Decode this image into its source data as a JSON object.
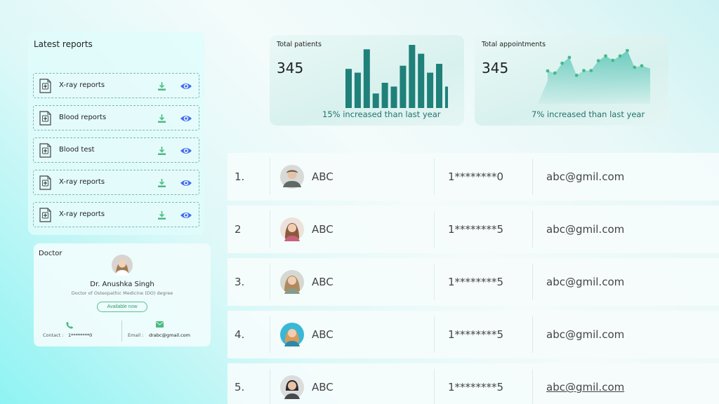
{
  "latest_reports": {
    "title": "Latest reports",
    "items": [
      {
        "label": "X-ray reports"
      },
      {
        "label": "Blood reports"
      },
      {
        "label": "Blood test"
      },
      {
        "label": "X-ray reports"
      },
      {
        "label": "X-ray reports"
      }
    ]
  },
  "doctor": {
    "heading": "Doctor",
    "name": "Dr. Anushka Singh",
    "degree": "Doctor of Osteopathic Medicine (DO) degree",
    "status_button": "Available now",
    "contact_label": "Contact :",
    "contact_value": "1********0",
    "email_label": "Email :",
    "email_value": "drabc@gmail.com"
  },
  "stats": {
    "patients": {
      "title": "Total patients",
      "value": "345",
      "note": "15% increased than last year",
      "bars": [
        0.62,
        0.56,
        0.93,
        0.23,
        0.4,
        0.34,
        0.67,
        1.0,
        0.86,
        0.56,
        0.7,
        0.34
      ]
    },
    "appointments": {
      "title": "Total appointments",
      "value": "345",
      "note": "7% increased than last year",
      "points": [
        0.44,
        0.38,
        0.65,
        0.81,
        0.32,
        0.45,
        0.45,
        0.72,
        0.85,
        0.73,
        0.85,
        1.0,
        0.54,
        0.58
      ]
    }
  },
  "patients_table": {
    "rows": [
      {
        "index": "1.",
        "name": "ABC",
        "phone": "1********0",
        "email": "abc@gmil.com"
      },
      {
        "index": "2",
        "name": "ABC",
        "phone": "1********5",
        "email": "abc@gmil.com"
      },
      {
        "index": "3.",
        "name": "ABC",
        "phone": "1********5",
        "email": "abc@gmil.com"
      },
      {
        "index": "4.",
        "name": "ABC",
        "phone": "1********5",
        "email": "abc@gmil.com"
      },
      {
        "index": "5.",
        "name": "ABC",
        "phone": "1********5",
        "email": "abc@gmil.com"
      }
    ]
  },
  "colors": {
    "bar": "#20807a",
    "area_top": "#5fc7b8",
    "point": "#47b98a",
    "download_icon": "#4cbb7f",
    "eye_icon": "#3f6ff0",
    "accent_text": "#22726c"
  },
  "icons": {
    "report": "medical-document-icon",
    "download": "download-icon",
    "view": "eye-icon",
    "phone": "phone-icon",
    "mail": "mail-icon"
  }
}
